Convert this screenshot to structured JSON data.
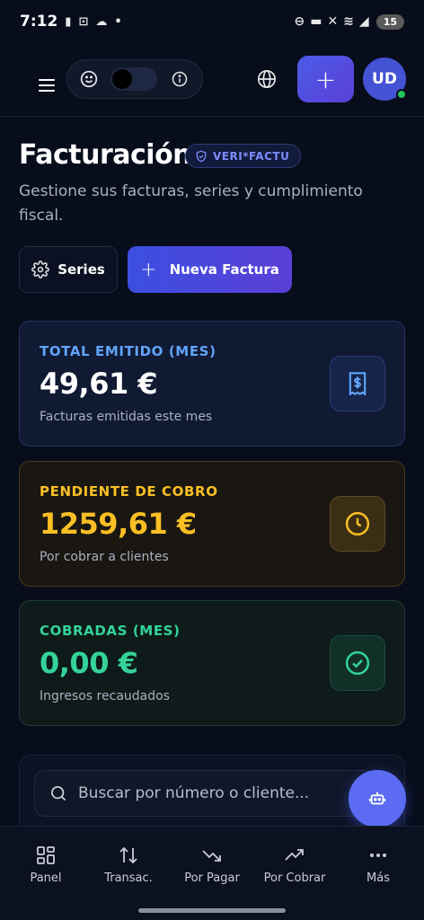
{
  "status_bar": {
    "time": "7:12",
    "battery": "15"
  },
  "header": {
    "avatar_initials": "UD"
  },
  "page": {
    "title": "Facturación",
    "badge": "VERI*FACTU",
    "subtitle": "Gestione sus facturas, series y cumplimiento fiscal."
  },
  "actions": {
    "series_label": "Series",
    "new_invoice_label": "Nueva Factura"
  },
  "cards": {
    "issued": {
      "label": "TOTAL EMITIDO (MES)",
      "amount": "49,61 €",
      "description": "Facturas emitidas este mes",
      "color": "#60a5fa",
      "icon": "receipt-dollar-icon"
    },
    "pending": {
      "label": "PENDIENTE DE COBRO",
      "amount": "1259,61 €",
      "description": "Por cobrar a clientes",
      "color": "#fbbf24",
      "icon": "clock-icon"
    },
    "collected": {
      "label": "COBRADAS (MES)",
      "amount": "0,00 €",
      "description": "Ingresos recaudados",
      "color": "#34d399",
      "icon": "check-circle-icon"
    }
  },
  "search": {
    "placeholder": "Buscar por número o cliente..."
  },
  "bottom_nav": {
    "items": [
      {
        "label": "Panel",
        "icon": "grid-icon"
      },
      {
        "label": "Transac.",
        "icon": "swap-vertical-icon"
      },
      {
        "label": "Por Pagar",
        "icon": "trending-down-icon"
      },
      {
        "label": "Por Cobrar",
        "icon": "trending-up-icon"
      },
      {
        "label": "Más",
        "icon": "more-dots-icon"
      }
    ]
  },
  "colors": {
    "accent": "#4b5ce8",
    "background": "#080d1c"
  }
}
